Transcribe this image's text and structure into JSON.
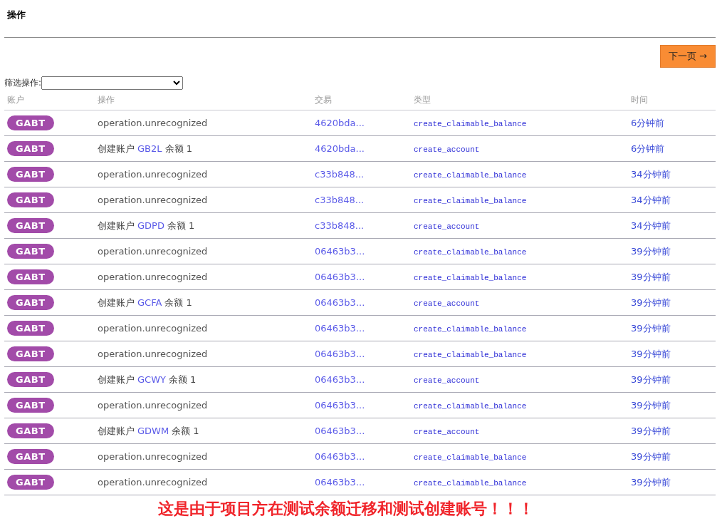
{
  "title": "操作",
  "next_button": {
    "label": "下一页 →"
  },
  "filter": {
    "label": "筛选操作:"
  },
  "table": {
    "columns": [
      "账户",
      "操作",
      "交易",
      "类型",
      "时间"
    ],
    "rows": [
      {
        "account": "GABT",
        "operation": {
          "kind": "unrecognized",
          "text": "operation.unrecognized"
        },
        "transaction": "4620bda...",
        "type": "create_claimable_balance",
        "time": "6分钟前"
      },
      {
        "account": "GABT",
        "operation": {
          "kind": "create_account",
          "label": "创建账户",
          "target": "GB2L",
          "balance": "余额 1"
        },
        "transaction": "4620bda...",
        "type": "create_account",
        "time": "6分钟前"
      },
      {
        "account": "GABT",
        "operation": {
          "kind": "unrecognized",
          "text": "operation.unrecognized"
        },
        "transaction": "c33b848...",
        "type": "create_claimable_balance",
        "time": "34分钟前"
      },
      {
        "account": "GABT",
        "operation": {
          "kind": "unrecognized",
          "text": "operation.unrecognized"
        },
        "transaction": "c33b848...",
        "type": "create_claimable_balance",
        "time": "34分钟前"
      },
      {
        "account": "GABT",
        "operation": {
          "kind": "create_account",
          "label": "创建账户",
          "target": "GDPD",
          "balance": "余额 1"
        },
        "transaction": "c33b848...",
        "type": "create_account",
        "time": "34分钟前"
      },
      {
        "account": "GABT",
        "operation": {
          "kind": "unrecognized",
          "text": "operation.unrecognized"
        },
        "transaction": "06463b3...",
        "type": "create_claimable_balance",
        "time": "39分钟前"
      },
      {
        "account": "GABT",
        "operation": {
          "kind": "unrecognized",
          "text": "operation.unrecognized"
        },
        "transaction": "06463b3...",
        "type": "create_claimable_balance",
        "time": "39分钟前"
      },
      {
        "account": "GABT",
        "operation": {
          "kind": "create_account",
          "label": "创建账户",
          "target": "GCFA",
          "balance": "余额 1"
        },
        "transaction": "06463b3...",
        "type": "create_account",
        "time": "39分钟前"
      },
      {
        "account": "GABT",
        "operation": {
          "kind": "unrecognized",
          "text": "operation.unrecognized"
        },
        "transaction": "06463b3...",
        "type": "create_claimable_balance",
        "time": "39分钟前"
      },
      {
        "account": "GABT",
        "operation": {
          "kind": "unrecognized",
          "text": "operation.unrecognized"
        },
        "transaction": "06463b3...",
        "type": "create_claimable_balance",
        "time": "39分钟前"
      },
      {
        "account": "GABT",
        "operation": {
          "kind": "create_account",
          "label": "创建账户",
          "target": "GCWY",
          "balance": "余额 1"
        },
        "transaction": "06463b3...",
        "type": "create_account",
        "time": "39分钟前"
      },
      {
        "account": "GABT",
        "operation": {
          "kind": "unrecognized",
          "text": "operation.unrecognized"
        },
        "transaction": "06463b3...",
        "type": "create_claimable_balance",
        "time": "39分钟前"
      },
      {
        "account": "GABT",
        "operation": {
          "kind": "create_account",
          "label": "创建账户",
          "target": "GDWM",
          "balance": "余额 1"
        },
        "transaction": "06463b3...",
        "type": "create_account",
        "time": "39分钟前"
      },
      {
        "account": "GABT",
        "operation": {
          "kind": "unrecognized",
          "text": "operation.unrecognized"
        },
        "transaction": "06463b3...",
        "type": "create_claimable_balance",
        "time": "39分钟前"
      },
      {
        "account": "GABT",
        "operation": {
          "kind": "unrecognized",
          "text": "operation.unrecognized"
        },
        "transaction": "06463b3...",
        "type": "create_claimable_balance",
        "time": "39分钟前"
      }
    ]
  },
  "caption": "这是由于项目方在测试余额迁移和测试创建账号！！！"
}
